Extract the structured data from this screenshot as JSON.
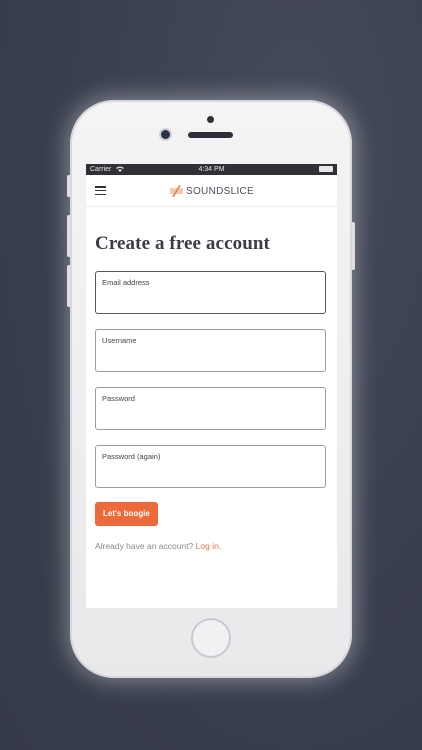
{
  "status_bar": {
    "carrier": "Carrier",
    "time": "4:34 PM"
  },
  "app": {
    "brand": "SOUNDSLICE",
    "brand_color": "#e8763f"
  },
  "page": {
    "title": "Create a free account"
  },
  "form": {
    "fields": [
      {
        "label": "Email address",
        "value": ""
      },
      {
        "label": "Username",
        "value": ""
      },
      {
        "label": "Password",
        "value": ""
      },
      {
        "label": "Password (again)",
        "value": ""
      }
    ],
    "submit_label": "Let's boogie",
    "submit_color": "#ed6a3a"
  },
  "login": {
    "prompt": "Already have an account?",
    "link_label": "Log in",
    "suffix": "."
  },
  "icons": [
    "menu-icon",
    "wifi-icon",
    "battery-icon",
    "soundslice-logo-mark"
  ]
}
